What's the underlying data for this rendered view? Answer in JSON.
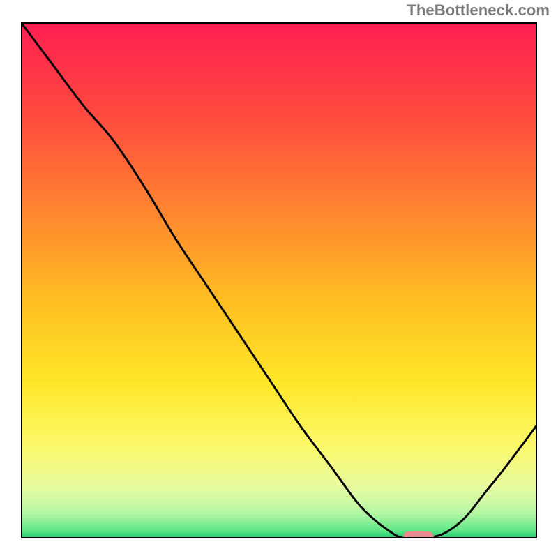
{
  "watermark": "TheBottleneck.com",
  "chart_data": {
    "type": "line",
    "title": "",
    "xlabel": "",
    "ylabel": "",
    "xlim": [
      0,
      100
    ],
    "ylim": [
      0,
      100
    ],
    "grid": false,
    "legend": false,
    "series": [
      {
        "name": "curve",
        "x": [
          0,
          6,
          12,
          18,
          24,
          30,
          36,
          42,
          48,
          54,
          60,
          66,
          72,
          75,
          78,
          82,
          86,
          90,
          94,
          100
        ],
        "y": [
          100,
          92,
          84,
          77,
          68,
          58,
          49,
          40,
          31,
          22,
          14,
          6,
          1,
          0,
          0,
          1,
          4,
          9,
          14,
          22
        ]
      }
    ],
    "highlight": {
      "name": "marker-pill",
      "x_range": [
        74,
        80
      ],
      "y": 0,
      "color": "#e88a8f"
    },
    "background_gradient": {
      "stops": [
        {
          "offset": 0.0,
          "color": "#ff1e52"
        },
        {
          "offset": 0.18,
          "color": "#ff4a3f"
        },
        {
          "offset": 0.38,
          "color": "#ff8a2e"
        },
        {
          "offset": 0.55,
          "color": "#ffc122"
        },
        {
          "offset": 0.7,
          "color": "#ffe729"
        },
        {
          "offset": 0.82,
          "color": "#fcf96a"
        },
        {
          "offset": 0.9,
          "color": "#e8fca0"
        },
        {
          "offset": 0.95,
          "color": "#b7f7a6"
        },
        {
          "offset": 0.985,
          "color": "#5ee687"
        },
        {
          "offset": 1.0,
          "color": "#18c96b"
        }
      ]
    },
    "frame_color": "#000000"
  }
}
